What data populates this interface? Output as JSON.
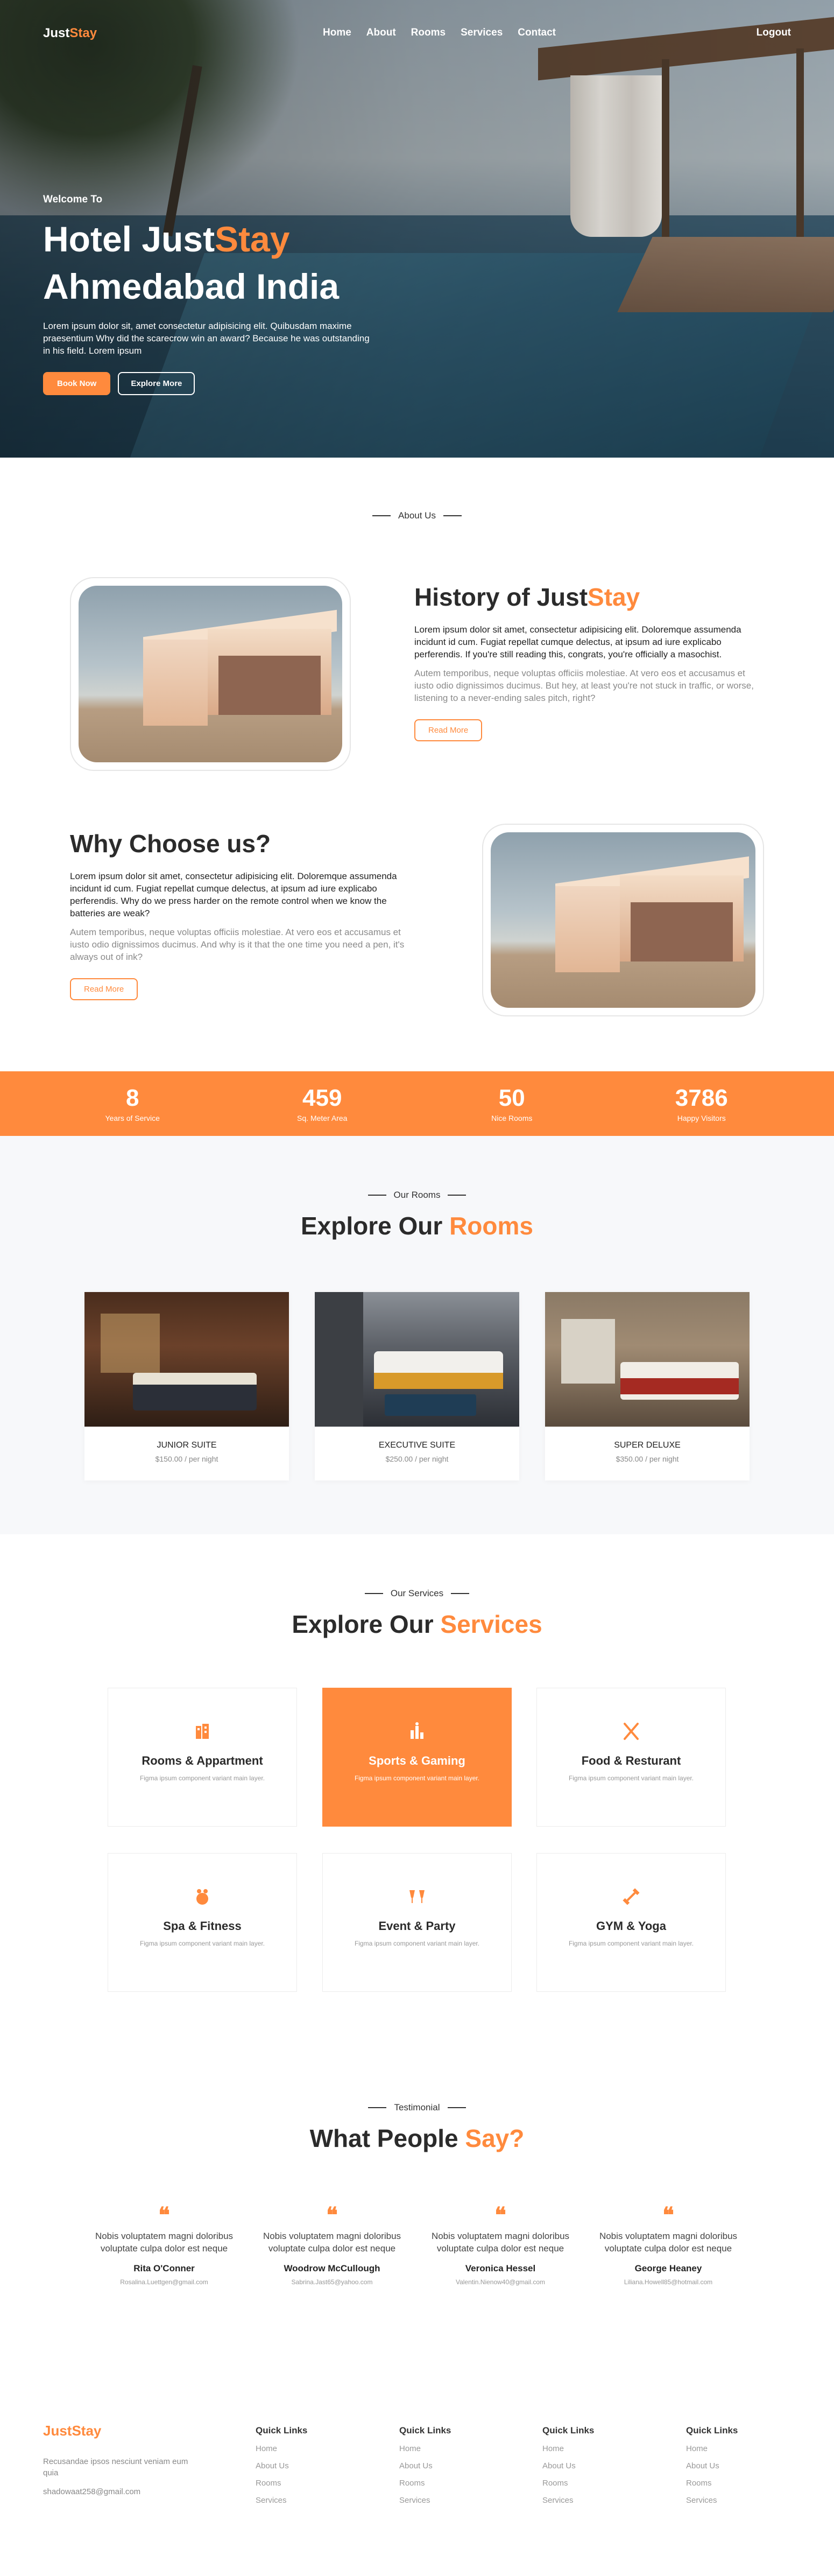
{
  "brand": {
    "name_part1": "Just",
    "name_part2": "Stay",
    "accent_color": "#ff8a3d"
  },
  "nav": {
    "links": [
      "Home",
      "About",
      "Rooms",
      "Services",
      "Contact"
    ],
    "logout": "Logout"
  },
  "hero": {
    "welcome": "Welcome To",
    "title_line1_part1": "Hotel Just",
    "title_line1_part2": "Stay",
    "title_line2": "Ahmedabad India",
    "description": "Lorem ipsum dolor sit, amet consectetur adipisicing elit. Quibusdam maxime praesentium Why did the scarecrow win an award? Because he was outstanding in his field. Lorem ipsum",
    "btn_book": "Book Now",
    "btn_explore": "Explore More"
  },
  "about": {
    "tag": "About Us",
    "history_title_part1": "History of Just",
    "history_title_part2": "Stay",
    "history_p1": "Lorem ipsum dolor sit amet, consectetur adipisicing elit. Doloremque assumenda incidunt id cum. Fugiat repellat cumque delectus, at ipsum ad iure explicabo perferendis. If you're still reading this, congrats, you're officially a masochist.",
    "history_p2": "Autem temporibus, neque voluptas officiis molestiae. At vero eos et accusamus et iusto odio dignissimos ducimus. But hey, at least you're not stuck in traffic, or worse, listening to a never-ending sales pitch, right?",
    "read_more": "Read More",
    "why_title": "Why Choose us?",
    "why_p1": "Lorem ipsum dolor sit amet, consectetur adipisicing elit. Doloremque assumenda incidunt id cum. Fugiat repellat cumque delectus, at ipsum ad iure explicabo perferendis. Why do we press harder on the remote control when we know the batteries are weak?",
    "why_p2": "Autem temporibus, neque voluptas officiis molestiae. At vero eos et accusamus et iusto odio dignissimos ducimus. And why is it that the one time you need a pen, it's always out of ink?",
    "why_read_more": "Read More"
  },
  "stats": [
    {
      "value": "8",
      "label": "Years of Service"
    },
    {
      "value": "459",
      "label": "Sq. Meter Area"
    },
    {
      "value": "50",
      "label": "Nice Rooms"
    },
    {
      "value": "3786",
      "label": "Happy Visitors"
    }
  ],
  "rooms": {
    "tag": "Our Rooms",
    "title_part1": "Explore Our ",
    "title_part2": "Rooms",
    "items": [
      {
        "name": "JUNIOR SUITE",
        "price": "$150.00 / per night"
      },
      {
        "name": "EXECUTIVE SUITE",
        "price": "$250.00 / per night"
      },
      {
        "name": "SUPER DELUXE",
        "price": "$350.00 / per night"
      }
    ]
  },
  "services": {
    "tag": "Our Services",
    "title_part1": "Explore Our ",
    "title_part2": "Services",
    "items": [
      {
        "title": "Rooms & Appartment",
        "desc": "Figma ipsum component variant main layer.",
        "icon": "building-icon"
      },
      {
        "title": "Sports & Gaming",
        "desc": "Figma ipsum component variant main layer.",
        "icon": "gaming-icon"
      },
      {
        "title": "Food & Resturant",
        "desc": "Figma ipsum component variant main layer.",
        "icon": "utensils-icon"
      },
      {
        "title": "Spa & Fitness",
        "desc": "Figma ipsum component variant main layer.",
        "icon": "spa-icon"
      },
      {
        "title": "Event & Party",
        "desc": "Figma ipsum component variant main layer.",
        "icon": "cheers-icon"
      },
      {
        "title": "GYM & Yoga",
        "desc": "Figma ipsum component variant main layer.",
        "icon": "dumbbell-icon"
      }
    ]
  },
  "testimonial": {
    "tag": "Testimonial",
    "title_part1": "What People ",
    "title_part2": "Say?",
    "quote_mark": "❝",
    "items": [
      {
        "text": "Nobis voluptatem magni doloribus voluptate culpa dolor est neque",
        "name": "Rita O'Conner",
        "email": "Rosalina.Luettgen@gmail.com"
      },
      {
        "text": "Nobis voluptatem magni doloribus voluptate culpa dolor est neque",
        "name": "Woodrow McCullough",
        "email": "Sabrina.Jast65@yahoo.com"
      },
      {
        "text": "Nobis voluptatem magni doloribus voluptate culpa dolor est neque",
        "name": "Veronica Hessel",
        "email": "Valentin.Nienow40@gmail.com"
      },
      {
        "text": "Nobis voluptatem magni doloribus voluptate culpa dolor est neque",
        "name": "George Heaney",
        "email": "Liliana.Howell85@hotmail.com"
      }
    ]
  },
  "footer": {
    "desc": "Recusandae ipsos nesciunt veniam eum quia",
    "email": "shadowaat258@gmail.com",
    "columns": [
      {
        "title": "Quick Links",
        "links": [
          "Home",
          "About Us",
          "Rooms",
          "Services"
        ]
      },
      {
        "title": "Quick Links",
        "links": [
          "Home",
          "About Us",
          "Rooms",
          "Services"
        ]
      },
      {
        "title": "Quick Links",
        "links": [
          "Home",
          "About Us",
          "Rooms",
          "Services"
        ]
      },
      {
        "title": "Quick Links",
        "links": [
          "Home",
          "About Us",
          "Rooms",
          "Services"
        ]
      }
    ]
  }
}
